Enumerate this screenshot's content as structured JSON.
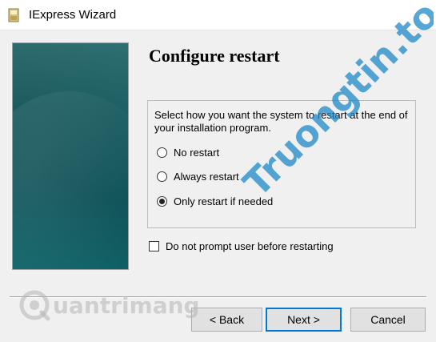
{
  "window": {
    "title": "IExpress Wizard"
  },
  "page": {
    "heading": "Configure restart",
    "description": "Select how you want the system to restart at the end of your installation program."
  },
  "restart_options": [
    {
      "label": "No restart",
      "checked": false
    },
    {
      "label": "Always restart",
      "checked": false
    },
    {
      "label": "Only restart if needed",
      "checked": true
    }
  ],
  "prompt_checkbox": {
    "label": "Do not prompt user before restarting",
    "checked": false
  },
  "buttons": {
    "back": "< Back",
    "next": "Next >",
    "cancel": "Cancel"
  },
  "watermarks": {
    "right": "Truongtin.top",
    "left": "uantrimang"
  },
  "colors": {
    "panel_teal": "#0f5d63",
    "accent_blue": "#0078d7",
    "watermark_blue": "#1e88c8",
    "watermark_orange": "#f5a623"
  }
}
